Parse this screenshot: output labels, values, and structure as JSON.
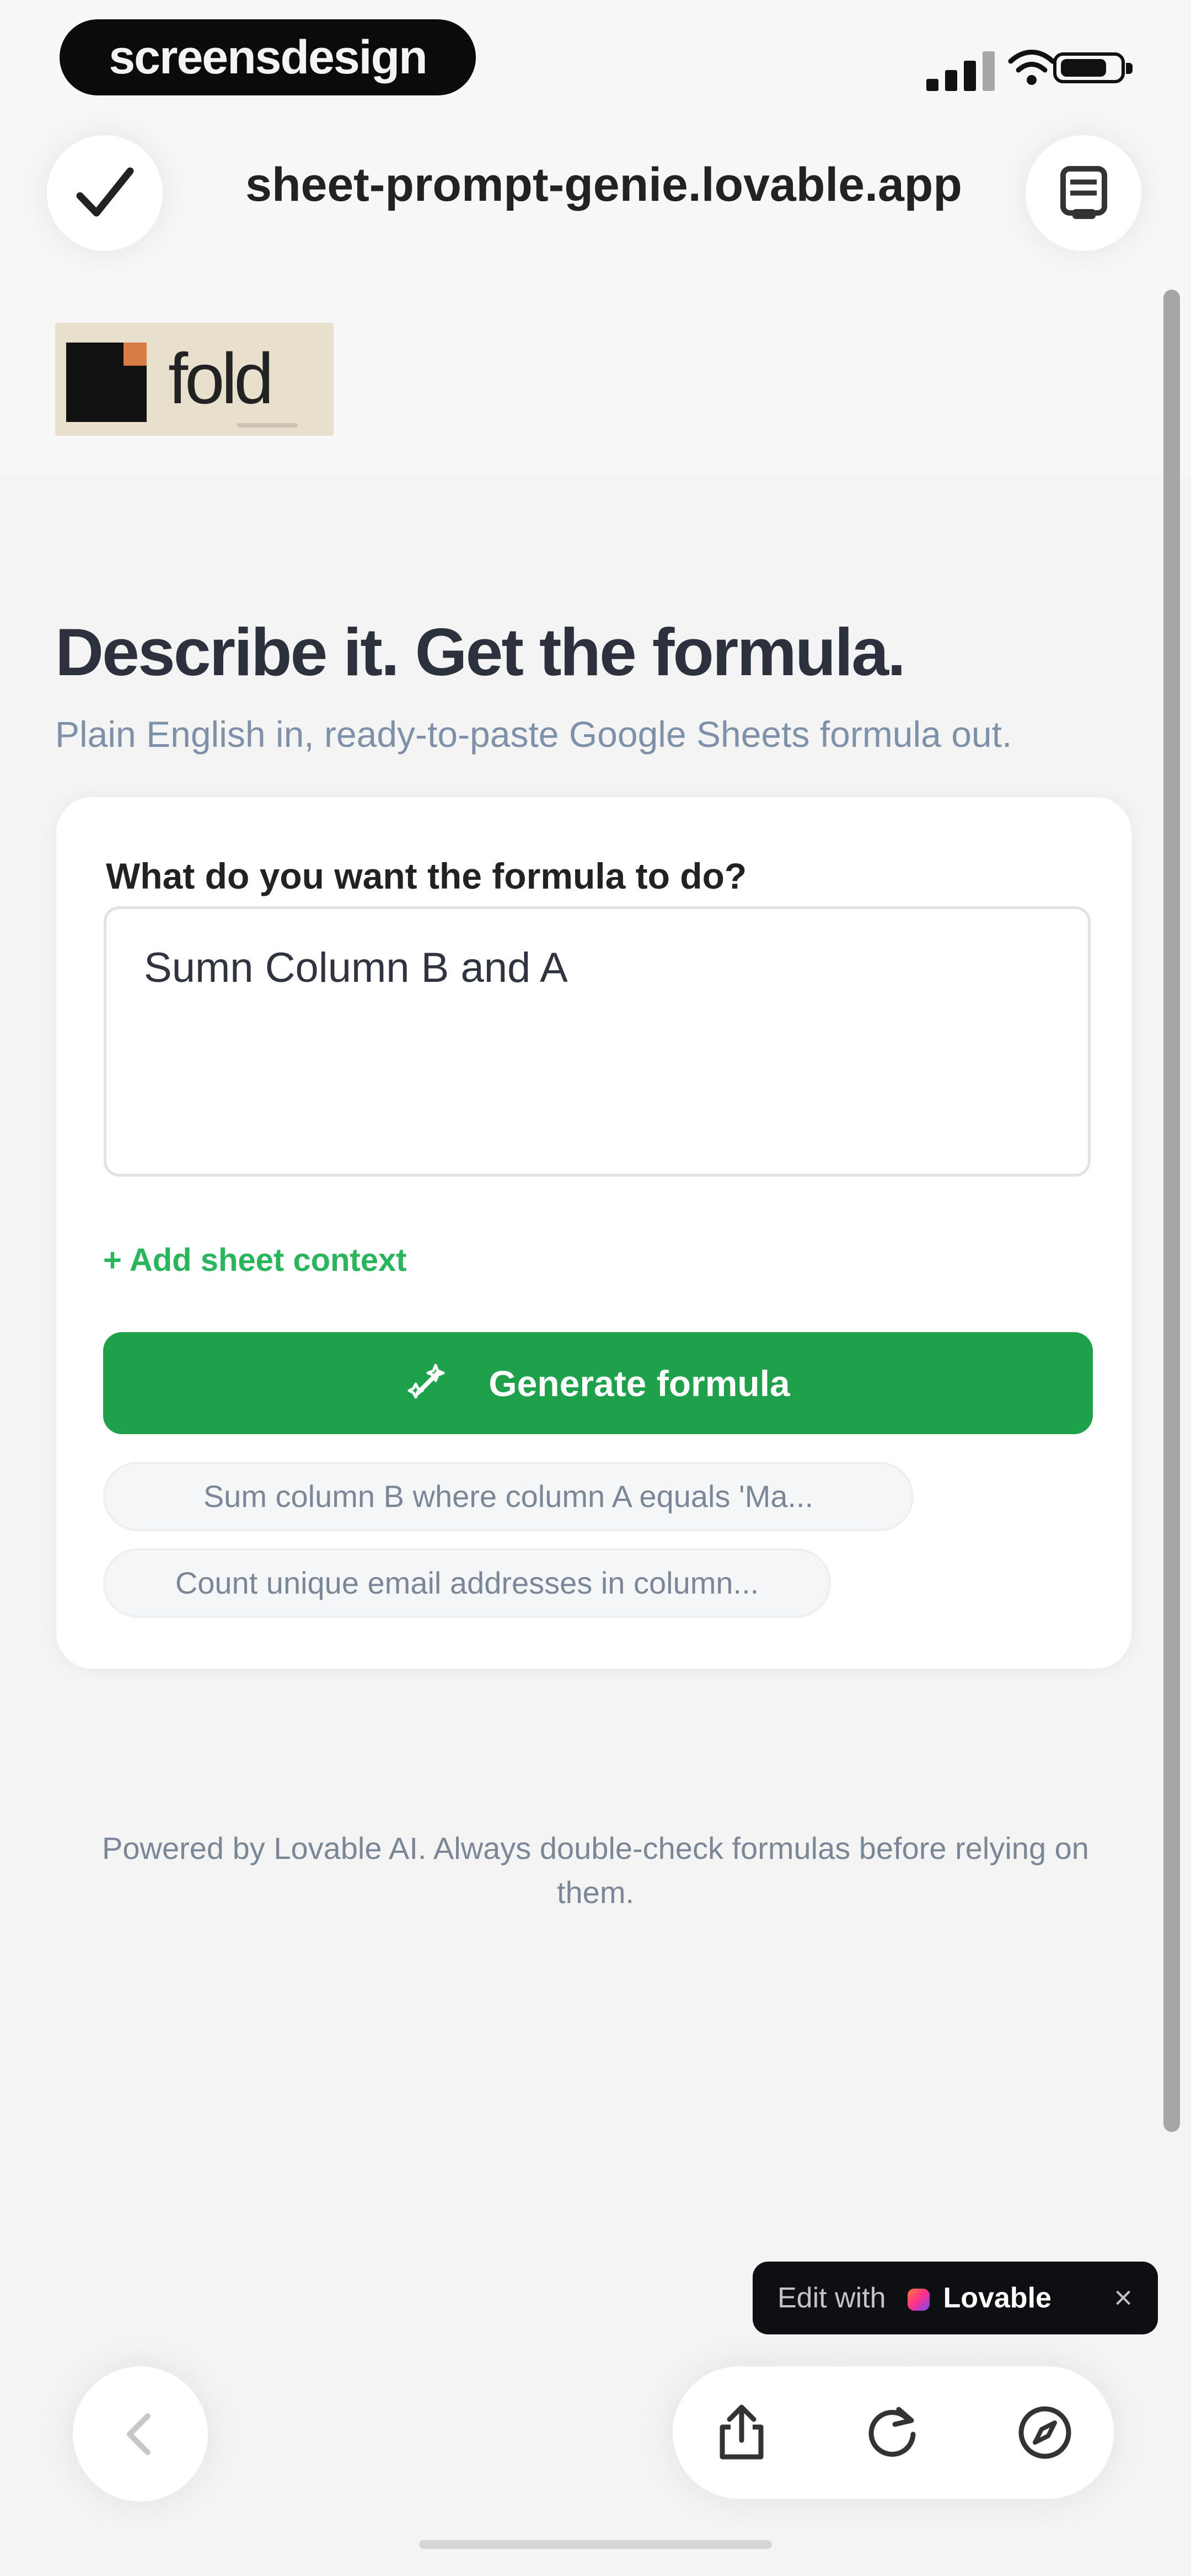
{
  "brand": {
    "watermark_text": "screensdesign",
    "logo_text": "fold",
    "accent_green": "#1fa04b",
    "link_green": "#2ab45c"
  },
  "browser": {
    "url": "sheet-prompt-genie.lovable.app",
    "check_icon": "check-icon",
    "reader_icon": "reader-mode-icon",
    "back_icon": "chevron-left-icon",
    "share_icon": "share-icon",
    "refresh_icon": "refresh-icon",
    "compass_icon": "compass-icon"
  },
  "page": {
    "title": "Describe it. Get the formula.",
    "subtitle": "Plain English in, ready-to-paste Google Sheets formula out."
  },
  "form": {
    "question_label": "What do you want the formula to do?",
    "input_value": "Sumn Column B and A",
    "add_context": "+ Add sheet context",
    "generate_button": "Generate formula",
    "examples": [
      "Sum column B where column A equals 'Ma...",
      "Count unique email addresses in column..."
    ]
  },
  "footer": {
    "note": "Powered by Lovable AI. Always double-check formulas before relying on them."
  },
  "badge": {
    "edit_with": "Edit with",
    "brand": "Lovable",
    "close": "×"
  }
}
